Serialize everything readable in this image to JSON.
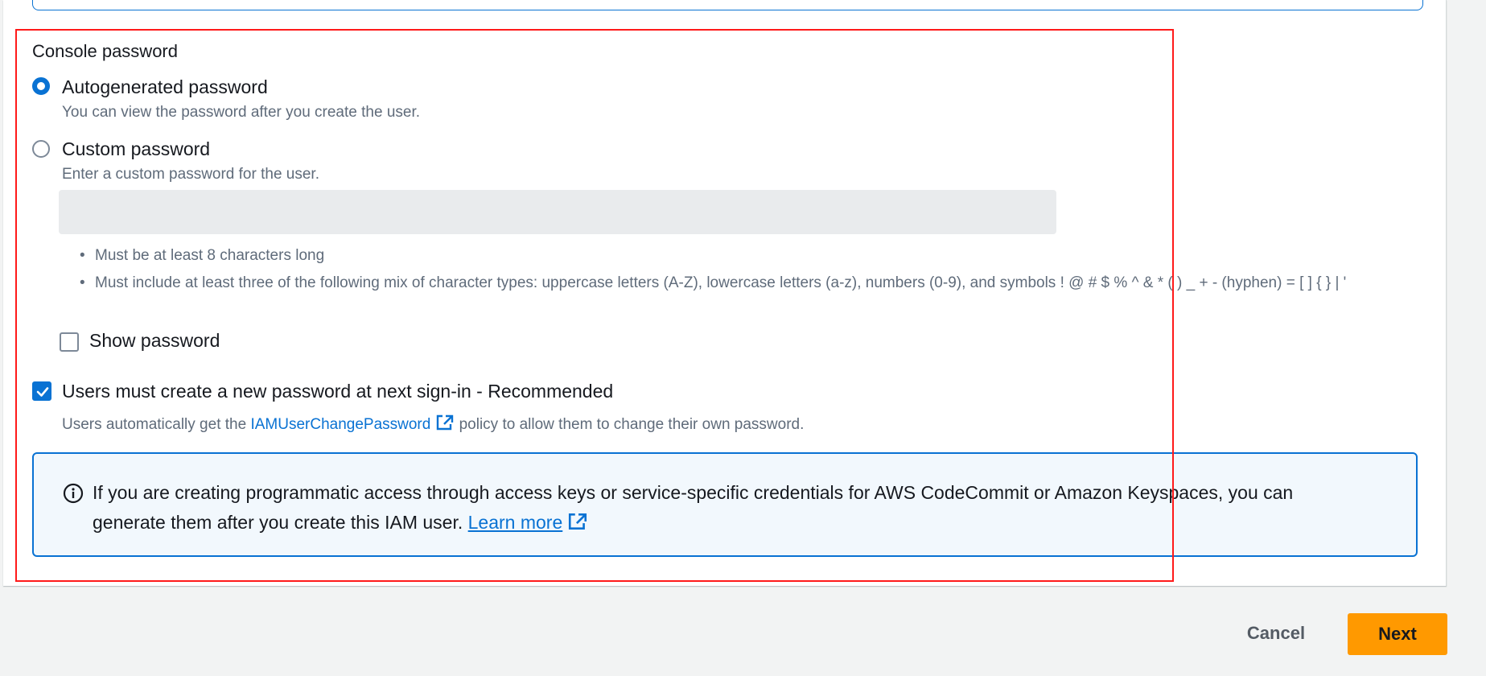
{
  "console_password": {
    "heading": "Console password",
    "options": [
      {
        "label": "Autogenerated password",
        "description": "You can view the password after you create the user.",
        "selected": true
      },
      {
        "label": "Custom password",
        "description": "Enter a custom password for the user.",
        "selected": false
      }
    ],
    "password_value": "",
    "requirements": [
      "Must be at least 8 characters long",
      "Must include at least three of the following mix of character types: uppercase letters (A-Z), lowercase letters (a-z), numbers (0-9), and symbols ! @ # $ % ^ & * ( ) _ + - (hyphen) = [ ] { } | '"
    ],
    "show_password_label": "Show password",
    "show_password_checked": false,
    "reset_required": {
      "label": "Users must create a new password at next sign-in - Recommended",
      "checked": true,
      "desc_prefix": "Users automatically get the",
      "policy_link": "IAMUserChangePassword",
      "desc_suffix": "policy to allow them to change their own password."
    }
  },
  "info_alert": {
    "text": "If you are creating programmatic access through access keys or service-specific credentials for AWS CodeCommit or Amazon Keyspaces, you can generate them after you create this IAM user.",
    "link": "Learn more"
  },
  "footer": {
    "cancel_label": "Cancel",
    "next_label": "Next"
  },
  "colors": {
    "accent": "#0972d3",
    "primary_button": "#ff9900",
    "highlight_box": "#ff1a1a",
    "info_background": "#f2f8fd"
  }
}
